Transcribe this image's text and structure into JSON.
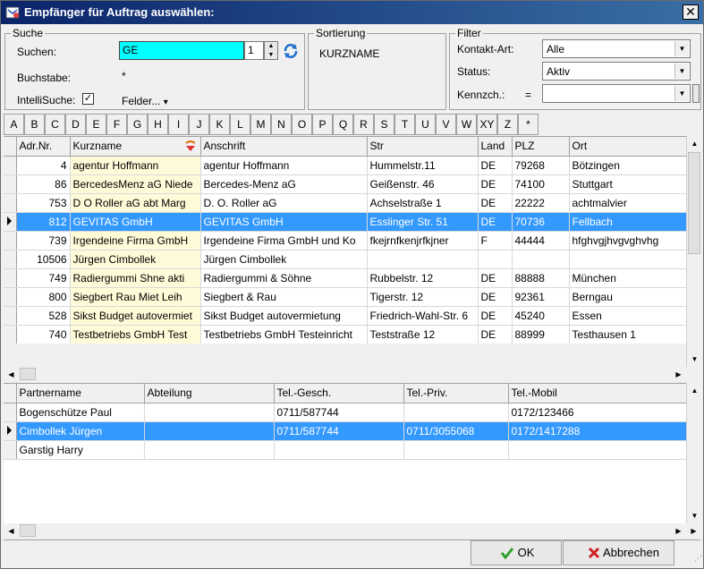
{
  "window": {
    "title": "Empfänger für Auftrag auswählen:",
    "close": "✕"
  },
  "suche": {
    "group_title": "Suche",
    "suchen_label": "Suchen:",
    "suchen_value": "GE",
    "spin_value": "1",
    "buchstabe_label": "Buchstabe:",
    "buchstabe_value": "*",
    "intellisuche_label": "IntelliSuche:",
    "intellisuche_checked": "✓",
    "felder_label": "Felder...",
    "felder_arrow": "▾"
  },
  "sortierung": {
    "group_title": "Sortierung",
    "value": "KURZNAME"
  },
  "filter": {
    "group_title": "Filter",
    "kontakt_label": "Kontakt-Art:",
    "kontakt_value": "Alle",
    "status_label": "Status:",
    "status_value": "Aktiv",
    "kennzch_label": "Kennzch.:",
    "kennzch_op": "=",
    "kennzch_value": ""
  },
  "letters": [
    "A",
    "B",
    "C",
    "D",
    "E",
    "F",
    "G",
    "H",
    "I",
    "J",
    "K",
    "L",
    "M",
    "N",
    "O",
    "P",
    "Q",
    "R",
    "S",
    "T",
    "U",
    "V",
    "W",
    "XY",
    "Z",
    "*"
  ],
  "addresses": {
    "columns": [
      "Adr.Nr.",
      "Kurzname",
      "Anschrift",
      "Str",
      "Land",
      "PLZ",
      "Ort"
    ],
    "rows": [
      {
        "nr": "4",
        "kurz": "agentur Hoffmann",
        "anschrift": "agentur Hoffmann",
        "str": "Hummelstr.11",
        "land": "DE",
        "plz": "79268",
        "ort": "Bötzingen"
      },
      {
        "nr": "86",
        "kurz": "BercedesMenz aG Niede",
        "anschrift": "Bercedes-Menz aG",
        "str": "Geißenstr. 46",
        "land": "DE",
        "plz": "74100",
        "ort": "Stuttgart"
      },
      {
        "nr": "753",
        "kurz": "D O Roller aG abt Marg",
        "anschrift": "D. O. Roller aG",
        "str": "Achselstraße 1",
        "land": "DE",
        "plz": "22222",
        "ort": "achtmalvier"
      },
      {
        "nr": "812",
        "kurz": "GEVITAS GmbH",
        "anschrift": "GEVITAS GmbH",
        "str": "Esslinger Str. 51",
        "land": "DE",
        "plz": "70736",
        "ort": "Fellbach"
      },
      {
        "nr": "739",
        "kurz": "Irgendeine Firma GmbH",
        "anschrift": "Irgendeine Firma GmbH und Ko",
        "str": "fkejrnfkenjrfkjner",
        "land": "F",
        "plz": "44444",
        "ort": "hfghvgjhvgvghvhg"
      },
      {
        "nr": "10506",
        "kurz": "Jürgen Cimbollek",
        "anschrift": "Jürgen Cimbollek",
        "str": "",
        "land": "",
        "plz": "",
        "ort": ""
      },
      {
        "nr": "749",
        "kurz": "Radiergummi  Shne  akti",
        "anschrift": "Radiergummi & Söhne",
        "str": "Rubbelstr. 12",
        "land": "DE",
        "plz": "88888",
        "ort": "München"
      },
      {
        "nr": "800",
        "kurz": "Siegbert  Rau  Miet  Leih",
        "anschrift": "Siegbert & Rau",
        "str": "Tigerstr. 12",
        "land": "DE",
        "plz": "92361",
        "ort": "Berngau"
      },
      {
        "nr": "528",
        "kurz": "Sikst Budget autovermiet",
        "anschrift": "Sikst Budget autovermietung",
        "str": "Friedrich-Wahl-Str. 6",
        "land": "DE",
        "plz": "45240",
        "ort": "Essen"
      },
      {
        "nr": "740",
        "kurz": "Testbetriebs GmbH Test",
        "anschrift": "Testbetriebs GmbH Testeinricht",
        "str": "Teststraße 12",
        "land": "DE",
        "plz": "88999",
        "ort": "Testhausen 1"
      }
    ]
  },
  "partners": {
    "columns": [
      "Partnername",
      "Abteilung",
      "Tel.-Gesch.",
      "Tel.-Priv.",
      "Tel.-Mobil"
    ],
    "rows": [
      {
        "name": "Bogenschütze Paul",
        "abt": "",
        "gesch": "0711/587744",
        "priv": "",
        "mobil": "0172/123466"
      },
      {
        "name": "Cimbollek Jürgen",
        "abt": "",
        "gesch": "0711/587744",
        "priv": "0711/3055068",
        "mobil": "0172/1417288"
      },
      {
        "name": "Garstig Harry",
        "abt": "",
        "gesch": "",
        "priv": "",
        "mobil": ""
      }
    ]
  },
  "buttons": {
    "ok": "OK",
    "abbrechen": "Abbrechen"
  },
  "colors": {
    "selection": "#3399ff",
    "highlight_input": "#00ffff",
    "kurzname_bg": "#fffbd9"
  }
}
